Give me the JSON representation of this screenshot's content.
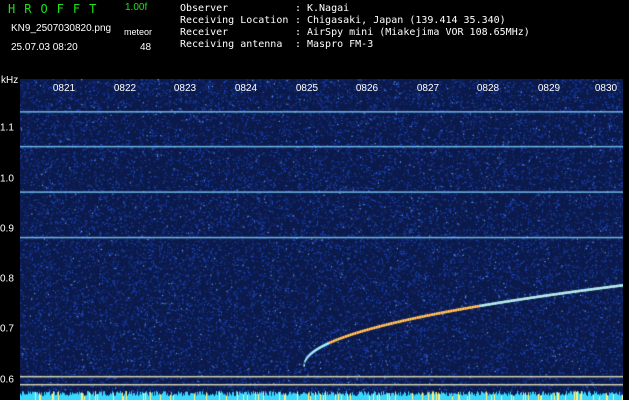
{
  "header": {
    "title": "HROFFT",
    "version": "1.00f",
    "filename": "KN9_2507030820.png",
    "mode": "meteor",
    "datetime": "25.07.03 08:20",
    "count": "48"
  },
  "info": [
    {
      "label": "Observer",
      "value": "K.Nagai"
    },
    {
      "label": "Receiving Location",
      "value": "Chigasaki, Japan (139.414 35.340)"
    },
    {
      "label": "Receiver",
      "value": "AirSpy mini (Miakejima VOR 108.65MHz)"
    },
    {
      "label": "Receiving antenna",
      "value": "Maspro FM-3"
    }
  ],
  "axis": {
    "y_unit": "kHz",
    "y_ticks": [
      "1.1",
      "1.0",
      "0.9",
      "0.8",
      "0.7",
      "0.6"
    ],
    "x_ticks": [
      "0821",
      "0822",
      "0823",
      "0824",
      "0825",
      "0826",
      "0827",
      "0828",
      "0829",
      "0830"
    ]
  },
  "spectrogram": {
    "freq_range_khz": [
      0.57,
      1.17
    ],
    "time_range": [
      "0820",
      "0830"
    ],
    "carrier_lines_khz": [
      1.11,
      1.045,
      0.96,
      0.875,
      0.615,
      0.6
    ],
    "meteor_trace": {
      "start_time": "0824.7",
      "end_time": "0830",
      "start_khz": 0.635,
      "end_khz": 0.785
    },
    "colors": {
      "background": "#0b1a4a",
      "noise": "#1f4fd6",
      "carrier": "#7fd0ff",
      "trace": "#ff6a2a"
    }
  }
}
